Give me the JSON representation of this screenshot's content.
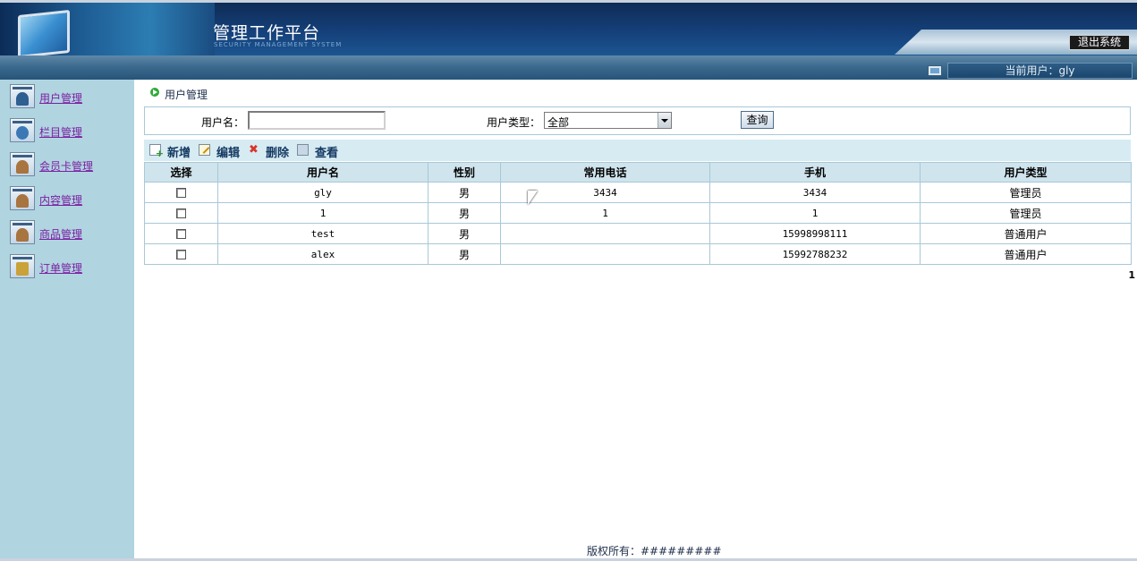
{
  "header": {
    "title": "管理工作平台",
    "subtitle": "SECURITY MANAGEMENT SYSTEM",
    "logout_label": "退出系统",
    "current_user": "当前用户：gly"
  },
  "sidebar": {
    "items": [
      {
        "label": "用户管理",
        "icon": "user-icon"
      },
      {
        "label": "栏目管理",
        "icon": "gear-icon"
      },
      {
        "label": "会员卡管理",
        "icon": "member-icon"
      },
      {
        "label": "内容管理",
        "icon": "content-icon"
      },
      {
        "label": "商品管理",
        "icon": "product-icon"
      },
      {
        "label": "订单管理",
        "icon": "order-icon"
      }
    ]
  },
  "main": {
    "breadcrumb": "用户管理",
    "search": {
      "username_label": "用户名：",
      "username_value": "",
      "usertype_label": "用户类型：",
      "usertype_value": "全部",
      "query_label": "查询"
    },
    "toolbar": {
      "new_label": "新增",
      "edit_label": "编辑",
      "delete_label": "删除",
      "view_label": "查看"
    },
    "table": {
      "headers": [
        "选择",
        "用户名",
        "性别",
        "常用电话",
        "手机",
        "用户类型"
      ],
      "rows": [
        {
          "username": "gly",
          "gender": "男",
          "phone": "3434",
          "mobile": "3434",
          "type": "管理员"
        },
        {
          "username": "1",
          "gender": "男",
          "phone": "1",
          "mobile": "1",
          "type": "管理员"
        },
        {
          "username": "test",
          "gender": "男",
          "phone": "",
          "mobile": "15998998111",
          "type": "普通用户"
        },
        {
          "username": "alex",
          "gender": "男",
          "phone": "",
          "mobile": "15992788232",
          "type": "普通用户"
        }
      ]
    },
    "pager": "1"
  },
  "footer": {
    "copyright": "版权所有：#########"
  },
  "colors": {
    "sidebar_bg": "#b0d4e0",
    "header_dark": "#12375f",
    "link_purple": "#7b1fa2",
    "grid_border": "#a8c8d8"
  }
}
